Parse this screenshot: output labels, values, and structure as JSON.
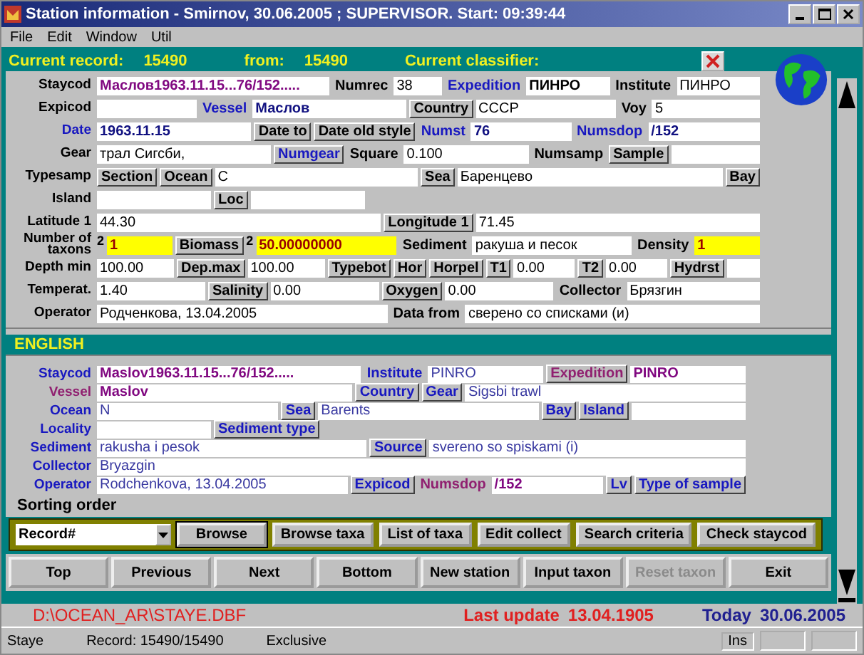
{
  "window": {
    "title": "Station information - Smirnov, 30.06.2005 ; SUPERVISOR. Start: 09:39:44"
  },
  "menu": [
    "File",
    "Edit",
    "Window",
    "Util"
  ],
  "header": {
    "record_label": "Current record:",
    "record": "15490",
    "from_label": "from:",
    "from": "15490",
    "classifier_label": "Current classifier:"
  },
  "russian": {
    "rows": [
      {
        "fields": [
          {
            "label": "Staycod",
            "value": {
              "text": "Маслов1963.11.15...76/152.....",
              "color": "#800880",
              "bold": true
            }
          },
          {
            "label": "Numrec",
            "value": {
              "text": "38"
            }
          },
          {
            "label": "Expedition",
            "color": "#1818c0",
            "value": {
              "text": "ПИНРО",
              "bold": true
            }
          },
          {
            "label": "Institute",
            "value": {
              "text": "ПИНРО"
            }
          }
        ]
      },
      {
        "fields": [
          {
            "label": "Expicod",
            "blank": true
          },
          {
            "label": "Vessel",
            "color": "#1818c0",
            "value": {
              "text": "Маслов",
              "color": "#101080",
              "bold": true
            }
          },
          {
            "label": "Country",
            "kind": "boxed",
            "value": {
              "text": "СССР"
            }
          },
          {
            "label": "Voy",
            "value": {
              "text": "5"
            }
          }
        ]
      },
      {
        "fields": [
          {
            "label": "Date",
            "color": "#1818c0",
            "value": {
              "text": "1963.11.15",
              "color": "#101080",
              "bold": true
            }
          },
          {
            "label": "Date to",
            "kind": "boxed"
          },
          {
            "label": "Date old style",
            "kind": "boxed"
          },
          {
            "label": "Numst",
            "color": "#1818c0",
            "value": {
              "text": "76",
              "color": "#101080",
              "bold": true
            }
          },
          {
            "label": "Numsdop",
            "color": "#1818c0",
            "value": {
              "text": "/152",
              "color": "#101080",
              "bold": true
            }
          }
        ]
      },
      {
        "fields": [
          {
            "label": "Gear",
            "value": {
              "text": "трал Сигсби,"
            }
          },
          {
            "label": "Numgear",
            "color": "#1818c0",
            "kind": "boxed"
          },
          {
            "label": "Square",
            "value": {
              "text": "0.100"
            }
          },
          {
            "label": "Numsamp"
          },
          {
            "label": "Sample",
            "kind": "boxed",
            "blank": true
          }
        ]
      },
      {
        "fields": [
          {
            "label": "Typesamp"
          },
          {
            "label": "Section",
            "kind": "boxed"
          },
          {
            "label": "Ocean",
            "kind": "boxed",
            "value": {
              "text": "С"
            }
          },
          {
            "label": "Sea",
            "kind": "boxed",
            "value": {
              "text": "Баренцево"
            }
          },
          {
            "label": "Bay",
            "kind": "boxed"
          }
        ]
      },
      {
        "fields": [
          {
            "label": "Island",
            "blank": true
          },
          {
            "label": "Loc",
            "kind": "boxed",
            "blank": true
          }
        ]
      },
      {
        "fields": [
          {
            "label": "Latitude 1",
            "value": {
              "text": "44.30"
            }
          },
          {
            "label": "Longitude 1",
            "kind": "boxed",
            "value": {
              "text": "71.45"
            }
          }
        ]
      },
      {
        "fields": [
          {
            "label": "Number of taxons",
            "note": "2",
            "value": {
              "text": "1",
              "highlight": true
            }
          },
          {
            "label": "Biomass",
            "kind": "boxed",
            "note": "2",
            "value": {
              "text": "50.00000000",
              "highlight": true
            }
          },
          {
            "label": "Sediment",
            "value": {
              "text": "ракуша и песок"
            }
          },
          {
            "label": "Density",
            "value": {
              "text": "1",
              "highlight": true
            }
          }
        ]
      },
      {
        "fields": [
          {
            "label": "Depth min",
            "value": {
              "text": "100.00"
            }
          },
          {
            "label": "Dep.max",
            "kind": "boxed",
            "value": {
              "text": "100.00"
            }
          },
          {
            "label": "Typebot",
            "kind": "boxed"
          },
          {
            "label": "Hor",
            "kind": "boxed"
          },
          {
            "label": "Horpel",
            "kind": "boxed"
          },
          {
            "label": "T1",
            "kind": "boxed",
            "value": {
              "text": "0.00"
            }
          },
          {
            "label": "T2",
            "kind": "boxed",
            "value": {
              "text": "0.00"
            }
          },
          {
            "label": "Hydrst",
            "kind": "boxed",
            "blank": true
          }
        ]
      },
      {
        "fields": [
          {
            "label": "Temperat.",
            "value": {
              "text": "1.40"
            }
          },
          {
            "label": "Salinity",
            "kind": "boxed",
            "value": {
              "text": "0.00"
            }
          },
          {
            "label": "Oxygen",
            "kind": "boxed",
            "value": {
              "text": "0.00"
            }
          },
          {
            "label": "Collector",
            "value": {
              "text": "Брязгин"
            }
          }
        ]
      },
      {
        "fields": [
          {
            "label": "Operator",
            "value": {
              "text": "Родченкова, 13.04.2005"
            }
          },
          {
            "label": "Data from",
            "value": {
              "text": "сверено со списками (и)"
            }
          }
        ]
      }
    ]
  },
  "english": {
    "title": "ENGLISH",
    "rows": [
      {
        "fields": [
          {
            "label": "Staycod",
            "color": "#1818c0",
            "value": {
              "text": "Maslov1963.11.15...76/152.....",
              "color": "#800880",
              "bold": true
            }
          },
          {
            "label": "Institute",
            "color": "#1818c0",
            "value": {
              "text": "PINRO",
              "color": "#3838a0"
            }
          },
          {
            "label": "Expedition",
            "color": "#902070",
            "kind": "boxed",
            "value": {
              "text": "PINRO",
              "color": "#800880",
              "bold": true
            }
          }
        ]
      },
      {
        "fields": [
          {
            "label": "Vessel",
            "color": "#902070",
            "value": {
              "text": "Maslov",
              "color": "#800880",
              "bold": true
            }
          },
          {
            "label": "Country",
            "color": "#1818c0",
            "kind": "boxed"
          },
          {
            "label": "Gear",
            "color": "#1818c0",
            "kind": "boxed",
            "value": {
              "text": "Sigsbi trawl",
              "color": "#3838a0"
            }
          }
        ]
      },
      {
        "fields": [
          {
            "label": "Ocean",
            "color": "#1818c0",
            "value": {
              "text": "N",
              "color": "#3838a0"
            }
          },
          {
            "label": "Sea",
            "color": "#1818c0",
            "kind": "boxed",
            "value": {
              "text": "Barents",
              "color": "#3838a0"
            }
          },
          {
            "label": "Bay",
            "color": "#1818c0",
            "kind": "boxed"
          },
          {
            "label": "Island",
            "color": "#1818c0",
            "kind": "boxed",
            "blank": true
          }
        ]
      },
      {
        "fields": [
          {
            "label": "Locality",
            "color": "#1818c0",
            "blank": true
          },
          {
            "label": "Sediment type",
            "color": "#1818c0",
            "kind": "boxed"
          }
        ]
      },
      {
        "fields": [
          {
            "label": "Sediment",
            "color": "#1818c0",
            "value": {
              "text": "rakusha i pesok",
              "color": "#3838a0"
            }
          },
          {
            "label": "Source",
            "color": "#1818c0",
            "kind": "boxed",
            "value": {
              "text": "svereno so spiskami (i)",
              "color": "#3838a0"
            }
          }
        ]
      },
      {
        "fields": [
          {
            "label": "Collector",
            "color": "#1818c0",
            "value": {
              "text": "Bryazgin",
              "color": "#3838a0"
            }
          }
        ]
      },
      {
        "fields": [
          {
            "label": "Operator",
            "color": "#1818c0",
            "value": {
              "text": "Rodchenkova, 13.04.2005",
              "color": "#3838a0"
            }
          },
          {
            "label": "Expicod",
            "color": "#1818c0",
            "kind": "boxed"
          },
          {
            "label": "Numsdop",
            "color": "#902070",
            "value": {
              "text": "/152",
              "color": "#800880",
              "bold": true
            }
          },
          {
            "label": "Lv",
            "color": "#1818c0",
            "kind": "boxed"
          },
          {
            "label": "Type of sample",
            "color": "#1818c0",
            "kind": "boxed"
          }
        ]
      }
    ]
  },
  "sorting": {
    "label": "Sorting order",
    "combo": "Record#",
    "buttons": [
      "Browse",
      "Browse taxa",
      "List of taxa",
      "Edit collect",
      "Search criteria",
      "Check staycod"
    ]
  },
  "nav_buttons": [
    {
      "label": "Top",
      "disabled": false
    },
    {
      "label": "Previous",
      "disabled": false
    },
    {
      "label": "Next",
      "disabled": false
    },
    {
      "label": "Bottom",
      "disabled": false
    },
    {
      "label": "New station",
      "disabled": false
    },
    {
      "label": "Input taxon",
      "disabled": false
    },
    {
      "label": "Reset taxon",
      "disabled": true
    },
    {
      "label": "Exit",
      "disabled": false
    }
  ],
  "footer": {
    "path": "D:\\OCEAN_AR\\STAYE.DBF",
    "last_update_label": "Last update",
    "last_update": "13.04.1905",
    "today_label": "Today",
    "today": "30.06.2005"
  },
  "status_bar": [
    "Staye",
    "Record: 15490/15490",
    "Exclusive",
    "Ins"
  ]
}
